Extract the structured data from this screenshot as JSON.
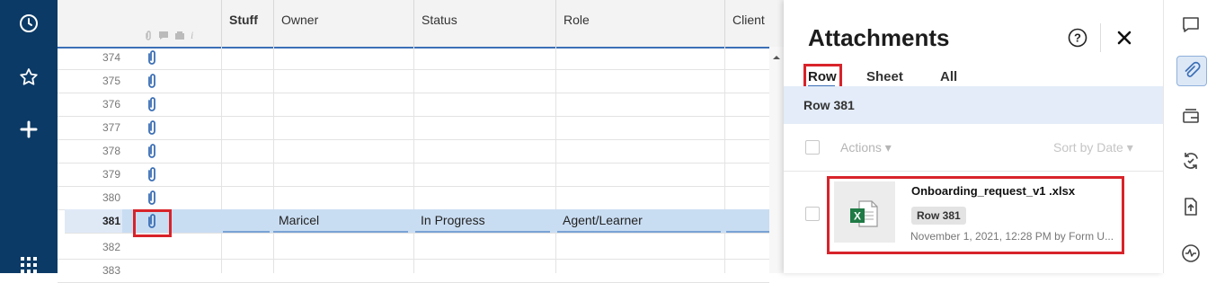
{
  "grid": {
    "columns": [
      "Stuff",
      "Owner",
      "Status",
      "Role",
      "Client"
    ],
    "rows": [
      {
        "num": "374"
      },
      {
        "num": "375"
      },
      {
        "num": "376"
      },
      {
        "num": "377"
      },
      {
        "num": "378"
      },
      {
        "num": "379"
      },
      {
        "num": "380"
      }
    ],
    "selected_row": {
      "num": "381",
      "owner": "Maricel",
      "status": "In Progress",
      "role": "Agent/Learner"
    },
    "after_rows": [
      {
        "num": "382"
      },
      {
        "num": "383"
      }
    ]
  },
  "panel": {
    "title": "Attachments",
    "tabs": [
      "Row",
      "Sheet",
      "All"
    ],
    "active_tab": "Row",
    "row_label": "Row 381",
    "actions_label": "Actions ▾",
    "sort_label": "Sort by Date ▾",
    "attachment": {
      "name": "Onboarding_request_v1 .xlsx",
      "badge": "Row 381",
      "meta": "November 1, 2021, 12:28 PM by Form U..."
    }
  },
  "colors": {
    "nav_bg": "#0b3a66",
    "accent": "#3b6fb6",
    "selected_row": "#c9ddf2",
    "highlight_box": "#d8232a",
    "excel_green": "#1f7a45"
  }
}
